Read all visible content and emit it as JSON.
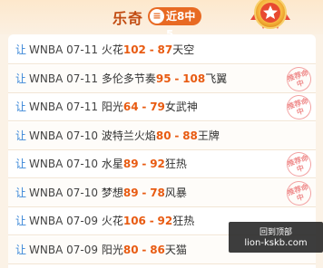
{
  "header": {
    "title": "乐奇",
    "badge_icon": "≡",
    "badge_text": "近8中5"
  },
  "rows": [
    {
      "rang": "让",
      "league": "WNBA",
      "date": "07-11",
      "home": "火花",
      "home_score": "102",
      "sep": "-",
      "away_score": "87",
      "away": "天空",
      "stamp": ""
    },
    {
      "rang": "让",
      "league": "WNBA",
      "date": "07-11",
      "home": "多伦多节奏",
      "home_score": "95",
      "sep": "-",
      "away_score": "108",
      "away": "飞翼",
      "stamp": "推荐命中"
    },
    {
      "rang": "让",
      "league": "WNBA",
      "date": "07-11",
      "home": "阳光",
      "home_score": "64",
      "sep": "-",
      "away_score": "79",
      "away": "女武神",
      "stamp": "推荐命中"
    },
    {
      "rang": "让",
      "league": "WNBA",
      "date": "07-10",
      "home": "波特兰火焰",
      "home_score": "80",
      "sep": "-",
      "away_score": "88",
      "away": "王牌",
      "stamp": ""
    },
    {
      "rang": "让",
      "league": "WNBA",
      "date": "07-10",
      "home": "水星",
      "home_score": "89",
      "sep": "-",
      "away_score": "92",
      "away": "狂热",
      "stamp": "推荐命中"
    },
    {
      "rang": "让",
      "league": "WNBA",
      "date": "07-10",
      "home": "梦想",
      "home_score": "89",
      "sep": "-",
      "away_score": "78",
      "away": "风暴",
      "stamp": "推荐命中"
    },
    {
      "rang": "让",
      "league": "WNBA",
      "date": "07-09",
      "home": "火花",
      "home_score": "106",
      "sep": "-",
      "away_score": "92",
      "away": "狂热",
      "stamp": ""
    },
    {
      "rang": "让",
      "league": "WNBA",
      "date": "07-09",
      "home": "阳光",
      "home_score": "80",
      "sep": "-",
      "away_score": "86",
      "away": "天猫",
      "stamp": ""
    }
  ],
  "tooltip": {
    "line1": "回到顶部",
    "line2": "lion-kskb.com"
  },
  "colors": {
    "accent": "#e86a23",
    "score": "#e85b12",
    "rang": "#3a87d8"
  }
}
